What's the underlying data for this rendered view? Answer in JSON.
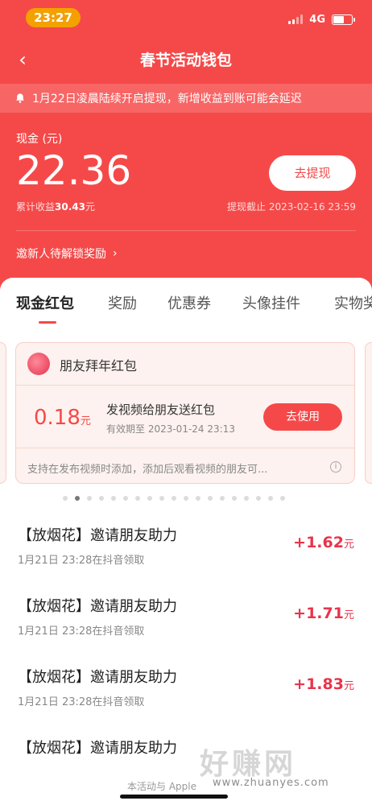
{
  "status_bar": {
    "time": "23:27",
    "network": "4G"
  },
  "header": {
    "title": "春节活动钱包"
  },
  "notice": {
    "text": "1月22日凌晨陆续开启提现，新增收益到账可能会延迟"
  },
  "wallet": {
    "cash_label": "现金 (元)",
    "cash_amount": "22.36",
    "cumulative_label": "累计收益",
    "cumulative_value": "30.43",
    "cumulative_unit": "元",
    "withdraw_button": "去提现",
    "deadline": "提现截止 2023-02-16 23:59",
    "invite_text": "邀新人待解锁奖励"
  },
  "tabs": [
    "现金红包",
    "奖励",
    "优惠券",
    "头像挂件",
    "实物奖"
  ],
  "card": {
    "title": "朋友拜年红包",
    "value": "0.18",
    "unit": "元",
    "desc": "发视频给朋友送红包",
    "expiry": "有效期至 2023-01-24 23:13",
    "use_button": "去使用",
    "note": "支持在发布视频时添加，添加后观看视频的朋友可..."
  },
  "pagination": {
    "total": 19,
    "active_index": 1
  },
  "records": [
    {
      "title": "【放烟花】邀请朋友助力",
      "time": "1月21日 23:28在抖音领取",
      "amount": "+1.62",
      "unit": "元"
    },
    {
      "title": "【放烟花】邀请朋友助力",
      "time": "1月21日 23:28在抖音领取",
      "amount": "+1.71",
      "unit": "元"
    },
    {
      "title": "【放烟花】邀请朋友助力",
      "time": "1月21日 23:28在抖音领取",
      "amount": "+1.83",
      "unit": "元"
    },
    {
      "title": "【放烟花】邀请朋友助力",
      "time": "",
      "amount": "",
      "unit": ""
    }
  ],
  "footer": {
    "text": "本活动与 Apple"
  },
  "watermark": {
    "text": "好赚网",
    "url": "www.zhuanyes.com"
  },
  "colors": {
    "primary": "#f54949",
    "amount": "#e8344b"
  }
}
